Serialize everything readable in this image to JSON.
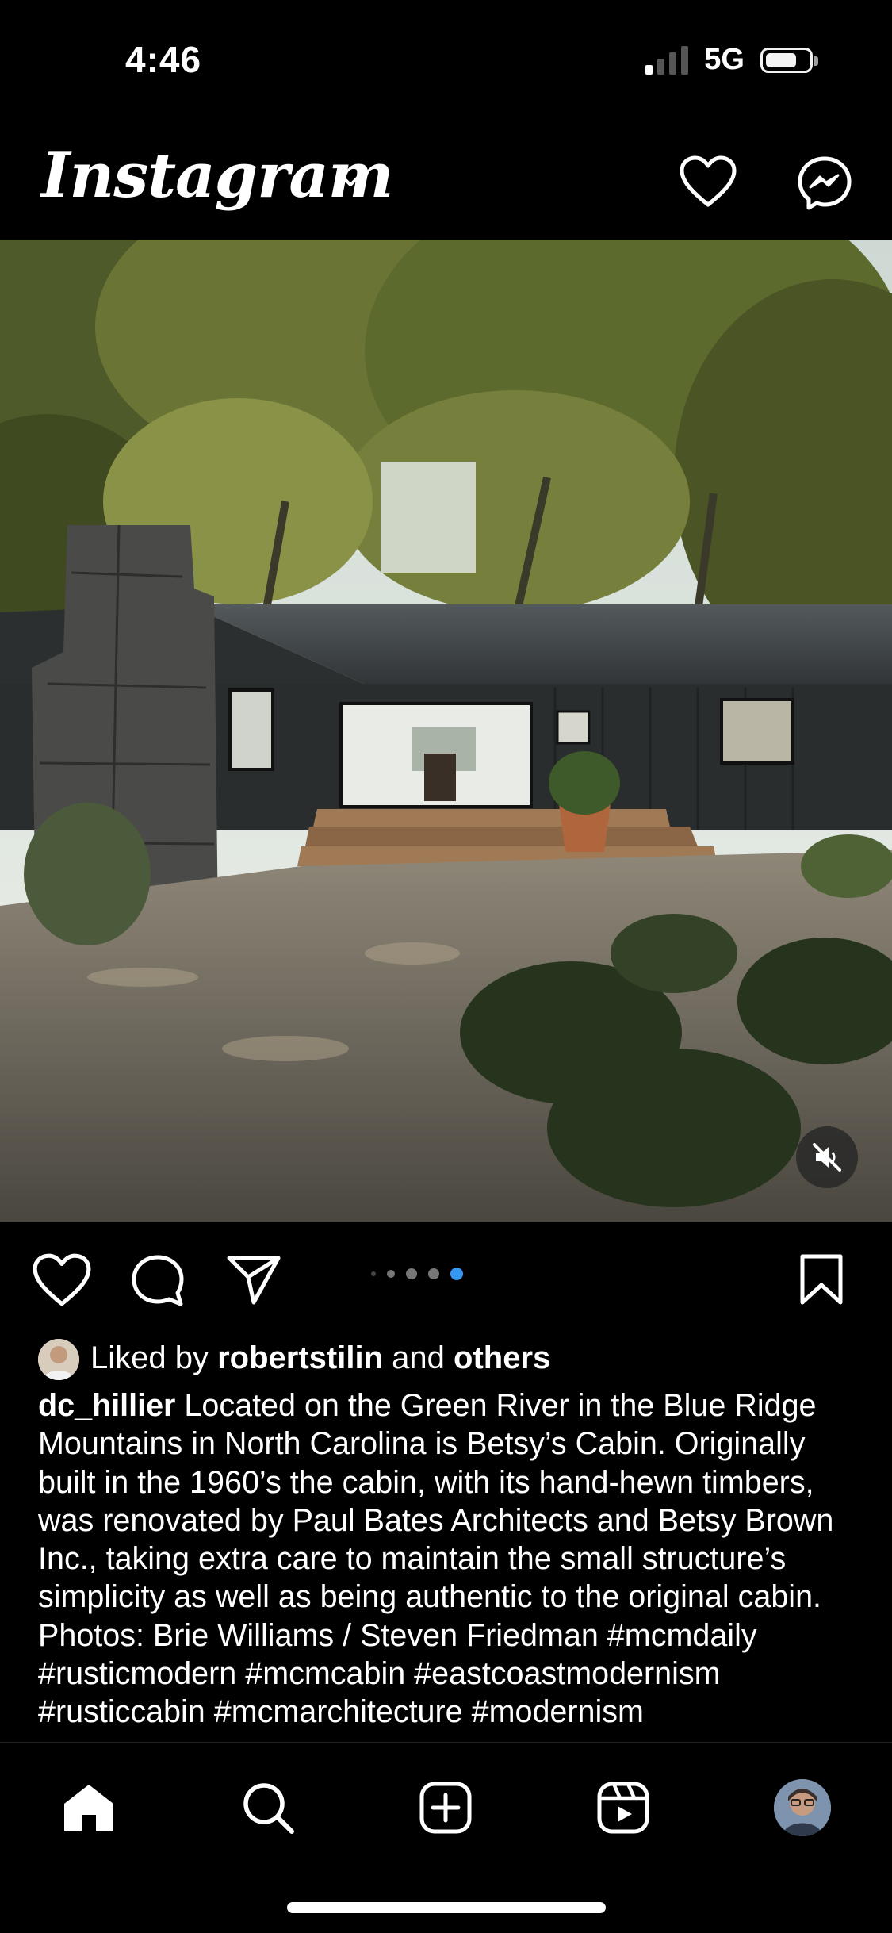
{
  "status_bar": {
    "time": "4:46",
    "network": "5G",
    "signal_bars_active": 1,
    "signal_bars_total": 4,
    "battery_level": 0.64
  },
  "header": {
    "logo_text": "Instagram",
    "icons": [
      "chevron-down-icon",
      "heart-icon",
      "messenger-icon"
    ]
  },
  "post": {
    "photo_description_icon": "cabin-photo",
    "carousel": {
      "count": 5,
      "active_index": 4,
      "accent": "#3897f0"
    },
    "muted": true,
    "likes": {
      "prefix": "Liked by",
      "user": "robertstilin",
      "and": "and",
      "others": "others"
    },
    "caption": {
      "username": "dc_hillier",
      "text": "Located on the Green River in the Blue Ridge Mountains in North Carolina is Betsy’s Cabin. Originally built in the 1960’s the cabin, with its hand-hewn timbers, was renovated by Paul Bates Architects and Betsy Brown Inc., taking extra care to maintain the small structure’s simplicity as well as being authentic to the original cabin. Photos: Brie Williams / Steven Friedman #mcmdaily #rusticmodern #mcmcabin #eastcoastmodernism #rusticcabin #mcmarchitecture #modernism"
    }
  },
  "tab_bar": {
    "tabs": [
      "home-icon",
      "search-icon",
      "create-icon",
      "reels-icon",
      "profile-avatar"
    ],
    "active": "home-icon"
  }
}
